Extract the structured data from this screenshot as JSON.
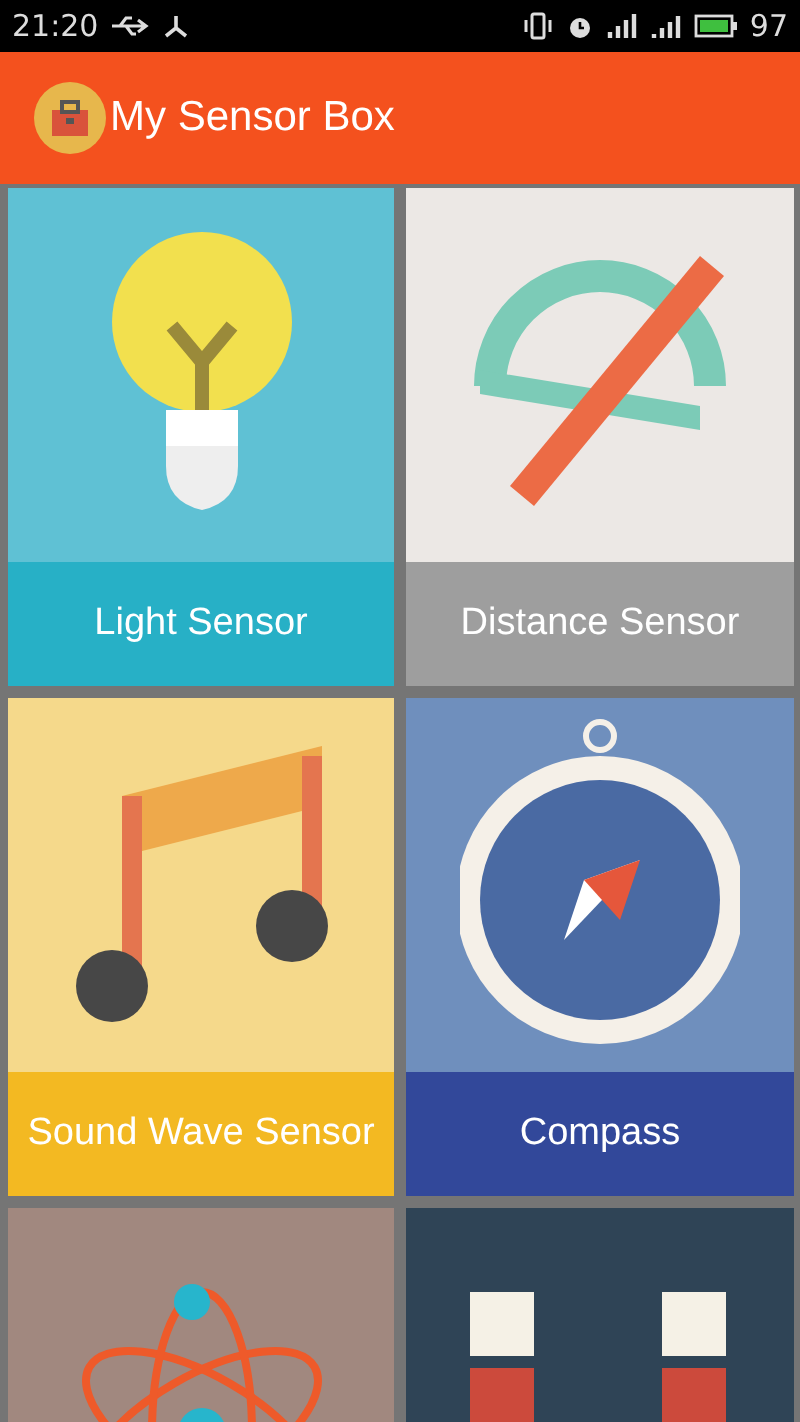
{
  "status_bar": {
    "time": "21:20",
    "battery": "97"
  },
  "app_bar": {
    "title": "My Sensor Box"
  },
  "tiles": [
    {
      "kind": "light",
      "label": "Light Sensor"
    },
    {
      "kind": "distance",
      "label": "Distance Sensor"
    },
    {
      "kind": "sound",
      "label": "Sound Wave Sensor"
    },
    {
      "kind": "compass",
      "label": "Compass"
    },
    {
      "kind": "atom"
    },
    {
      "kind": "magnet"
    }
  ]
}
